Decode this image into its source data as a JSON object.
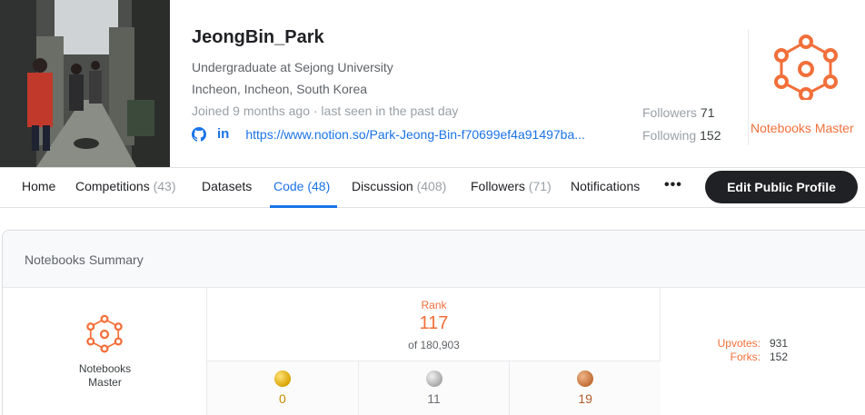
{
  "profile": {
    "name": "JeongBin_Park",
    "occupation": "Undergraduate at Sejong University",
    "location": "Incheon, Incheon, South Korea",
    "activity": "Joined 9 months ago · last seen in the past day",
    "website": "https://www.notion.so/Park-Jeong-Bin-f70699ef4a91497ba...",
    "linkedin_label": "in",
    "followers_label": "Followers",
    "followers_count": "71",
    "following_label": "Following",
    "following_count": "152",
    "tier_label": "Notebooks Master",
    "accent_color": "#f26f3a"
  },
  "nav": {
    "tabs": [
      {
        "label": "Home",
        "count": ""
      },
      {
        "label": "Competitions",
        "count": "(43)"
      },
      {
        "label": "Datasets",
        "count": ""
      },
      {
        "label": "Code",
        "count": "(48)",
        "active": true
      },
      {
        "label": "Discussion",
        "count": "(408)"
      },
      {
        "label": "Followers",
        "count": "(71)"
      },
      {
        "label": "Notifications",
        "count": ""
      }
    ],
    "more_label": "•••",
    "edit_button": "Edit Public Profile"
  },
  "summary": {
    "title": "Notebooks Summary",
    "tier_label_line1": "Notebooks",
    "tier_label_line2": "Master",
    "rank_label": "Rank",
    "rank_value": "117",
    "rank_of": "of 180,903",
    "medals": {
      "gold": "0",
      "silver": "11",
      "bronze": "19"
    },
    "upvotes_label": "Upvotes:",
    "upvotes_value": "931",
    "forks_label": "Forks:",
    "forks_value": "152"
  }
}
